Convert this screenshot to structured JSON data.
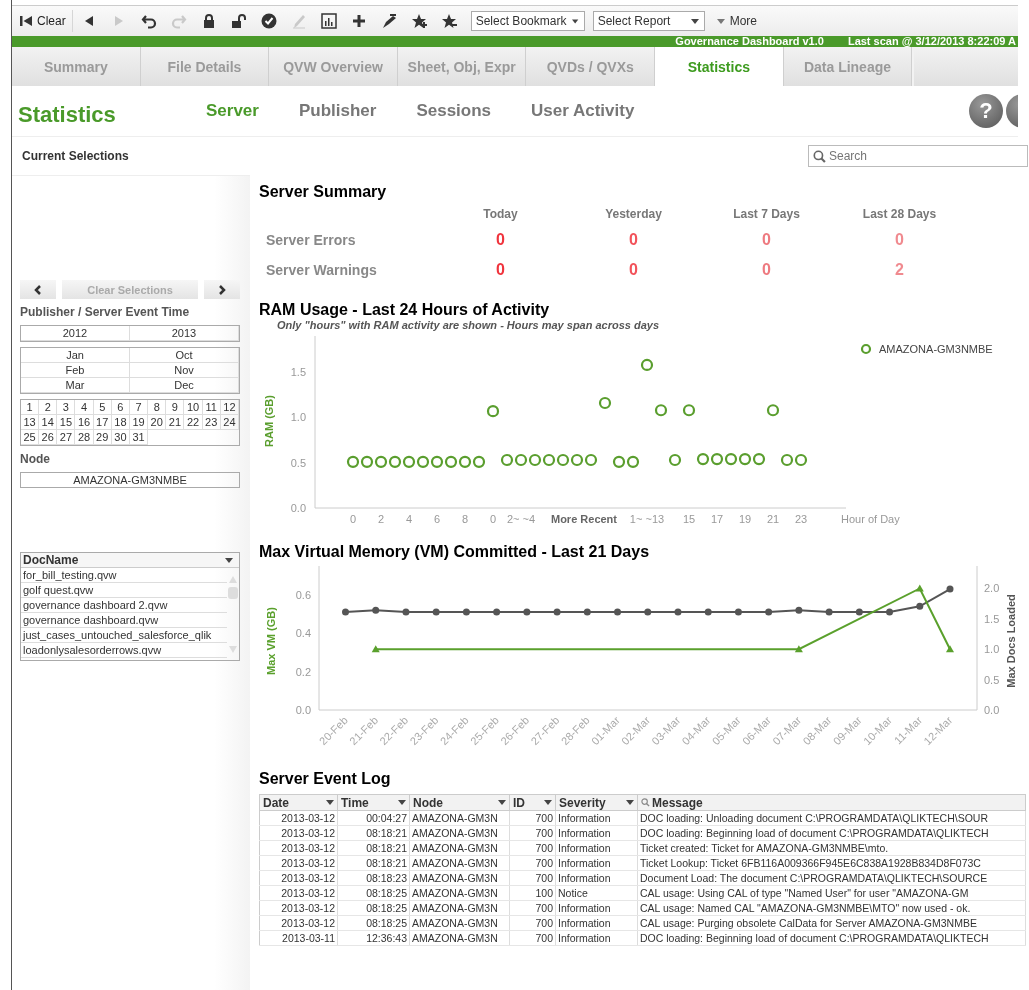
{
  "toolbar": {
    "clear_button": {
      "label": "Clear"
    },
    "buttons": [
      {
        "kind": "back",
        "disabled": false
      },
      {
        "kind": "forward",
        "disabled": true
      },
      {
        "kind": "undo",
        "disabled": false
      },
      {
        "kind": "redo",
        "disabled": true
      },
      {
        "kind": "lock",
        "disabled": false
      },
      {
        "kind": "unlock",
        "disabled": false
      },
      {
        "kind": "check",
        "disabled": false
      },
      {
        "kind": "pencil",
        "disabled": true
      },
      {
        "kind": "chart",
        "disabled": false
      },
      {
        "kind": "plus",
        "disabled": false
      },
      {
        "kind": "pen",
        "disabled": false
      },
      {
        "kind": "star-add",
        "disabled": false
      },
      {
        "kind": "star-remove",
        "disabled": false
      }
    ],
    "dropdowns": [
      "Select Bookmark",
      "Select Report"
    ],
    "more": "More"
  },
  "banner": {
    "title": "Governance Dashboard v1.0",
    "last_scan": "Last scan @ 3/12/2013 8:22:09 A"
  },
  "tabs": [
    {
      "label": "Summary",
      "selected": false
    },
    {
      "label": "File Details",
      "selected": false
    },
    {
      "label": "QVW Overview",
      "selected": false
    },
    {
      "label": "Sheet, Obj, Expr",
      "selected": false
    },
    {
      "label": "QVDs / QVXs",
      "selected": false
    },
    {
      "label": "Statistics",
      "selected": true
    },
    {
      "label": "Data Lineage",
      "selected": false
    }
  ],
  "page_title": "Statistics",
  "subtabs": [
    {
      "label": "Server",
      "selected": true
    },
    {
      "label": "Publisher",
      "selected": false
    },
    {
      "label": "Sessions",
      "selected": false
    },
    {
      "label": "User Activity",
      "selected": false
    }
  ],
  "help_button": "?",
  "current_selections": "Current Selections",
  "search": {
    "placeholder": "Search"
  },
  "sidebar": {
    "clear_selections": "Clear Selections",
    "time_title": "Publisher / Server Event Time",
    "years": [
      "2012",
      "2013"
    ],
    "months": [
      "Jan",
      "Oct",
      "Feb",
      "Nov",
      "Mar",
      "Dec"
    ],
    "days": [
      "1",
      "2",
      "3",
      "4",
      "5",
      "6",
      "7",
      "8",
      "9",
      "10",
      "11",
      "12",
      "13",
      "14",
      "15",
      "16",
      "17",
      "18",
      "19",
      "20",
      "21",
      "22",
      "23",
      "24",
      "25",
      "26",
      "27",
      "28",
      "29",
      "30",
      "31"
    ],
    "node_title": "Node",
    "nodes": [
      "AMAZONA-GM3NMBE"
    ],
    "doclist": {
      "header": "DocName",
      "items": [
        "for_bill_testing.qvw",
        "golf quest.qvw",
        "governance dashboard 2.qvw",
        "governance dashboard.qvw",
        "just_cases_untouched_salesforce_qlik",
        "loadonlysalesorderrows.qvw"
      ]
    }
  },
  "server_summary": {
    "title": "Server Summary",
    "columns": [
      "Today",
      "Yesterday",
      "Last 7 Days",
      "Last 28 Days"
    ],
    "rows": [
      {
        "label": "Server Errors",
        "values": [
          {
            "value": "0",
            "color": "#f0343d"
          },
          {
            "value": "0",
            "color": "#f2525a"
          },
          {
            "value": "0",
            "color": "#ee7a80"
          },
          {
            "value": "0",
            "color": "#f08a8f"
          }
        ]
      },
      {
        "label": "Server Warnings",
        "values": [
          {
            "value": "0",
            "color": "#f0343d"
          },
          {
            "value": "0",
            "color": "#f2525a"
          },
          {
            "value": "0",
            "color": "#ee7a80"
          },
          {
            "value": "2",
            "color": "#f08a8f"
          }
        ]
      }
    ]
  },
  "ram_chart": {
    "title": "RAM Usage - Last 24 Hours of Activity",
    "subtitle": "Only \"hours\" with RAM activity are shown - Hours may span across days",
    "x_annotation": "More Recent",
    "chart_data": {
      "type": "scatter",
      "xlabel": "Hour of Day",
      "ylabel": "RAM (GB)",
      "categories": [
        "0",
        null,
        "2",
        null,
        "4",
        null,
        "6",
        null,
        "8",
        null,
        "0",
        null,
        "2~ ~4",
        null,
        null,
        null,
        null,
        null,
        null,
        null,
        null,
        "1~ ~13",
        null,
        null,
        "15",
        null,
        "17",
        null,
        "19",
        null,
        "21",
        null,
        "23"
      ],
      "series": [
        {
          "name": "AMAZONA-GM3NMBE",
          "color": "#5a9e2e",
          "values": [
            0.51,
            0.51,
            0.51,
            0.51,
            0.51,
            0.51,
            0.51,
            0.51,
            0.51,
            0.51,
            1.07,
            0.53,
            0.53,
            0.53,
            0.53,
            0.53,
            0.53,
            0.53,
            1.16,
            0.51,
            0.51,
            1.58,
            1.08,
            0.53,
            1.08,
            0.54,
            0.54,
            0.54,
            0.54,
            0.54,
            1.08,
            0.53,
            0.53
          ]
        }
      ],
      "ylim": [
        0,
        1.9
      ],
      "yticks": [
        {
          "value": 0,
          "label": "0.0"
        },
        {
          "value": 0.5,
          "label": "0.5"
        },
        {
          "value": 1,
          "label": "1.0"
        },
        {
          "value": 1.5,
          "label": "1.5"
        }
      ]
    }
  },
  "vm_chart": {
    "chart_data": {
      "type": "line",
      "title": "Max Virtual Memory (VM) Committed - Last 21 Days",
      "ylabel": "Max VM (GB)",
      "y2label": "Max Docs Loaded",
      "categories": [
        "20-Feb",
        "21-Feb",
        "22-Feb",
        "23-Feb",
        "24-Feb",
        "25-Feb",
        "26-Feb",
        "27-Feb",
        "28-Feb",
        "01-Mar",
        "02-Mar",
        "03-Mar",
        "04-Mar",
        "05-Mar",
        "06-Mar",
        "07-Mar",
        "08-Mar",
        "09-Mar",
        "10-Mar",
        "11-Mar",
        "12-Mar"
      ],
      "series": [
        {
          "color": "#555555",
          "marker": "circle",
          "values": [
            0.51,
            0.52,
            0.51,
            0.51,
            0.51,
            0.51,
            0.51,
            0.51,
            0.51,
            0.51,
            0.51,
            0.51,
            0.51,
            0.51,
            0.51,
            0.52,
            0.51,
            0.51,
            0.51,
            0.54,
            0.63
          ]
        },
        {
          "color": "#5aa02c",
          "axis": "y2",
          "marker": "triangle",
          "values": [
            null,
            1,
            null,
            null,
            null,
            null,
            null,
            null,
            null,
            null,
            null,
            null,
            null,
            null,
            null,
            1,
            null,
            null,
            null,
            2,
            1
          ]
        }
      ],
      "ylim": [
        0,
        0.75
      ],
      "y2lim": [
        0,
        2.37
      ],
      "yticks": [
        {
          "value": 0,
          "label": "0.0"
        },
        {
          "value": 0.2,
          "label": "0.2"
        },
        {
          "value": 0.4,
          "label": "0.4"
        },
        {
          "value": 0.6,
          "label": "0.6"
        }
      ],
      "y2ticks": [
        {
          "value": 0,
          "label": "0.0"
        },
        {
          "value": 0.5,
          "label": "0.5"
        },
        {
          "value": 1,
          "label": "1.0"
        },
        {
          "value": 1.5,
          "label": "1.5"
        },
        {
          "value": 2,
          "label": "2.0"
        }
      ]
    }
  },
  "event_log": {
    "title": "Server Event Log",
    "columns": [
      "Date",
      "Time",
      "Node",
      "ID",
      "Severity",
      "Message"
    ],
    "rows": [
      [
        "2013-03-12",
        "00:04:27",
        "AMAZONA-GM3N",
        "700",
        "Information",
        "DOC loading: Unloading document C:\\PROGRAMDATA\\QLIKTECH\\SOUR"
      ],
      [
        "2013-03-12",
        "08:18:21",
        "AMAZONA-GM3N",
        "700",
        "Information",
        "DOC loading: Beginning load of document C:\\PROGRAMDATA\\QLIKTECH"
      ],
      [
        "2013-03-12",
        "08:18:21",
        "AMAZONA-GM3N",
        "700",
        "Information",
        "Ticket created: Ticket for AMAZONA-GM3NMBE\\mto."
      ],
      [
        "2013-03-12",
        "08:18:21",
        "AMAZONA-GM3N",
        "700",
        "Information",
        "Ticket Lookup: Ticket 6FB116A009366F945E6C838A1928B834D8F073C"
      ],
      [
        "2013-03-12",
        "08:18:23",
        "AMAZONA-GM3N",
        "700",
        "Information",
        "Document Load: The document C:\\PROGRAMDATA\\QLIKTECH\\SOURCE"
      ],
      [
        "2013-03-12",
        "08:18:25",
        "AMAZONA-GM3N",
        "100",
        "Notice",
        "CAL usage: Using CAL of type \"Named User\" for user \"AMAZONA-GM"
      ],
      [
        "2013-03-12",
        "08:18:25",
        "AMAZONA-GM3N",
        "700",
        "Information",
        "CAL usage: Named CAL \"AMAZONA-GM3NMBE\\MTO\" now used - ok."
      ],
      [
        "2013-03-12",
        "08:18:25",
        "AMAZONA-GM3N",
        "700",
        "Information",
        "CAL usage: Purging obsolete CalData for Server AMAZONA-GM3NMBE"
      ],
      [
        "2013-03-11",
        "12:36:43",
        "AMAZONA-GM3N",
        "700",
        "Information",
        "DOC loading: Beginning load of document C:\\PROGRAMDATA\\QLIKTECH"
      ]
    ]
  }
}
